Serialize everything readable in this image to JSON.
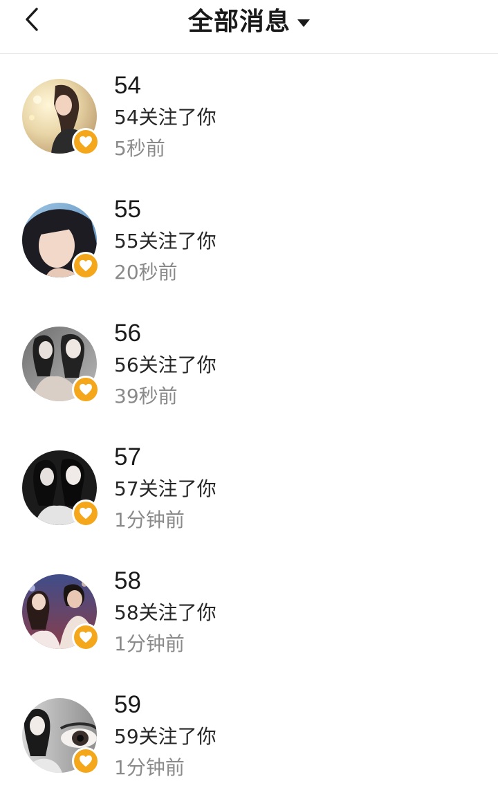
{
  "header": {
    "title": "全部消息",
    "back_icon": "chevron-left-icon",
    "dropdown_icon": "caret-down-icon"
  },
  "colors": {
    "badge": "#f5a71b",
    "divider": "#e6e6e6",
    "time_text": "#8a8a8a"
  },
  "notifications": [
    {
      "name": "54",
      "message": "54关注了你",
      "time": "5秒前",
      "badge_icon": "heart-icon"
    },
    {
      "name": "55",
      "message": "55关注了你",
      "time": "20秒前",
      "badge_icon": "heart-icon"
    },
    {
      "name": "56",
      "message": "56关注了你",
      "time": "39秒前",
      "badge_icon": "heart-icon"
    },
    {
      "name": "57",
      "message": "57关注了你",
      "time": "1分钟前",
      "badge_icon": "heart-icon"
    },
    {
      "name": "58",
      "message": "58关注了你",
      "time": "1分钟前",
      "badge_icon": "heart-icon"
    },
    {
      "name": "59",
      "message": "59关注了你",
      "time": "1分钟前",
      "badge_icon": "heart-icon"
    }
  ]
}
